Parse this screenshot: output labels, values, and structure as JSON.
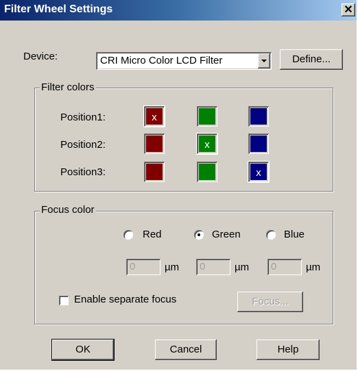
{
  "window": {
    "title": "Filter Wheel Settings",
    "close_glyph": "✕"
  },
  "device": {
    "label": "Device:",
    "selected": "CRI Micro Color LCD Filter",
    "define_label": "Define..."
  },
  "filter_colors": {
    "legend": "Filter colors",
    "rows": [
      {
        "label": "Position1:",
        "selected_index": 0
      },
      {
        "label": "Position2:",
        "selected_index": 1
      },
      {
        "label": "Position3:",
        "selected_index": 2
      }
    ],
    "colors": [
      "#800000",
      "#008000",
      "#000080"
    ],
    "mark": "x"
  },
  "focus_color": {
    "legend": "Focus color",
    "options": [
      {
        "label": "Red",
        "checked": false
      },
      {
        "label": "Green",
        "checked": true
      },
      {
        "label": "Blue",
        "checked": false
      }
    ],
    "values": [
      "0",
      "0",
      "0"
    ],
    "unit": "µm",
    "enable_separate_focus": "Enable separate focus",
    "focus_button": "Focus..."
  },
  "buttons": {
    "ok": "OK",
    "cancel": "Cancel",
    "help": "Help"
  }
}
